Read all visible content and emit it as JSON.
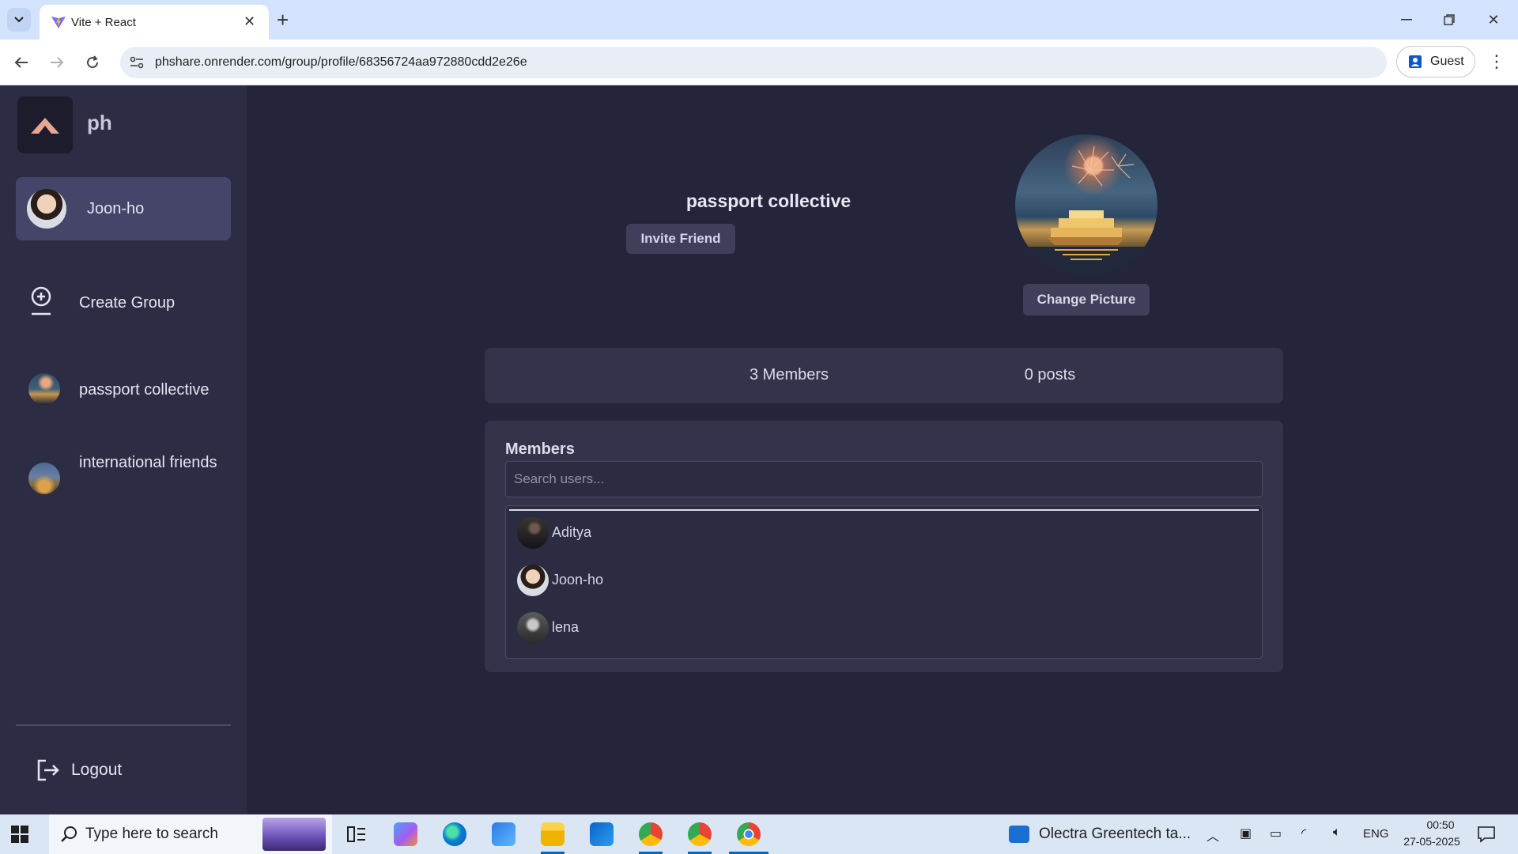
{
  "browser": {
    "tab_title": "Vite + React",
    "url": "phshare.onrender.com/group/profile/68356724aa972880cdd2e26e",
    "profile_label": "Guest"
  },
  "sidebar": {
    "app_name": "ph",
    "user_name": "Joon-ho",
    "create_group_label": "Create Group",
    "groups": [
      {
        "name": "passport collective"
      },
      {
        "name": "international friends"
      }
    ],
    "logout_label": "Logout"
  },
  "group": {
    "title": "passport collective",
    "invite_label": "Invite Friend",
    "change_picture_label": "Change Picture",
    "members_count": "3 Members",
    "posts_count": "0 posts",
    "members_heading": "Members",
    "search_placeholder": "Search users...",
    "members": [
      {
        "name": "Aditya"
      },
      {
        "name": "Joon-ho"
      },
      {
        "name": "lena"
      }
    ]
  },
  "taskbar": {
    "search_text": "Type here to search",
    "news_text": "Olectra Greentech ta...",
    "language": "ENG",
    "time": "00:50",
    "date": "27-05-2025"
  },
  "colors": {
    "sidebar_bg": "#2c2c44",
    "main_bg": "#24243a",
    "card_bg": "#33334c",
    "active_item": "#45456a"
  }
}
